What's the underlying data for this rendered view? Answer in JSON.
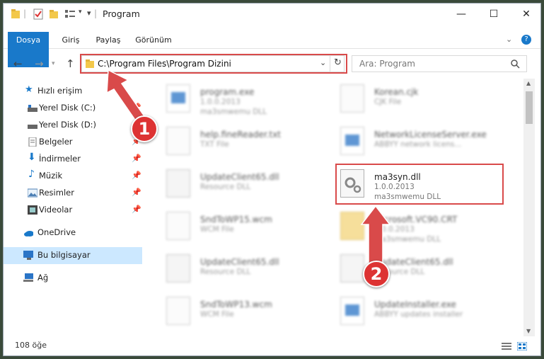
{
  "window": {
    "title": "Program",
    "controls": {
      "minimize": "—",
      "maximize": "☐",
      "close": "✕"
    }
  },
  "ribbon": {
    "tabs": [
      "Dosya",
      "Giriş",
      "Paylaş",
      "Görünüm"
    ]
  },
  "address": {
    "path": "C:\\Program Files\\Program Dizini",
    "search_placeholder": "Ara: Program"
  },
  "sidebar": {
    "items": [
      {
        "label": "Hızlı erişim",
        "icon": "star-icon"
      },
      {
        "label": "Yerel Disk (C:)",
        "icon": "drive-icon",
        "pinned": true
      },
      {
        "label": "Yerel Disk (D:)",
        "icon": "drive-icon"
      },
      {
        "label": "Belgeler",
        "icon": "documents-icon",
        "pinned": true
      },
      {
        "label": "İndirmeler",
        "icon": "download-icon",
        "pinned": true
      },
      {
        "label": "Müzik",
        "icon": "music-icon",
        "pinned": true
      },
      {
        "label": "Resimler",
        "icon": "pictures-icon",
        "pinned": true
      },
      {
        "label": "Videolar",
        "icon": "videos-icon",
        "pinned": true
      },
      {
        "label": "OneDrive",
        "icon": "cloud-icon"
      },
      {
        "label": "Bu bilgisayar",
        "icon": "computer-icon",
        "selected": true
      },
      {
        "label": "Ağ",
        "icon": "network-icon"
      }
    ]
  },
  "files": [
    {
      "name": "program.exe",
      "line2": "1.0.0.2013",
      "line3": "ma3smwemu DLL",
      "icon": "exe-file-icon"
    },
    {
      "name": "Korean.cjk",
      "line2": "CJK File",
      "line3": "",
      "icon": "document-icon"
    },
    {
      "name": "help.fineReader.txt",
      "line2": "TXT File",
      "line3": "",
      "icon": "document-icon"
    },
    {
      "name": "NetworkLicenseServer.exe",
      "line2": "ABBYY network licens...",
      "line3": "",
      "icon": "exe-file-icon"
    },
    {
      "name": "UpdateClient65.dll",
      "line2": "Resource DLL",
      "line3": "",
      "icon": "dll-file-icon"
    },
    {
      "name": "ma3syn.dll",
      "line2": "1.0.0.2013",
      "line3": "ma3smwemu DLL",
      "icon": "dll-file-icon"
    },
    {
      "name": "SndToWP15.wcm",
      "line2": "WCM File",
      "line3": "",
      "icon": "document-icon"
    },
    {
      "name": "Microsoft.VC90.CRT",
      "line2": "1.0.0.2013",
      "line3": "ma3smwemu DLL",
      "icon": "folder-icon"
    },
    {
      "name": "UpdateClient65.dll",
      "line2": "Resource DLL",
      "line3": "",
      "icon": "dll-file-icon"
    },
    {
      "name": "UpdateClient65.dll",
      "line2": "Resource DLL",
      "line3": "",
      "icon": "dll-file-icon"
    },
    {
      "name": "SndToWP13.wcm",
      "line2": "WCM File",
      "line3": "",
      "icon": "document-icon"
    },
    {
      "name": "UpdateInstaller.exe",
      "line2": "ABBYY updates installer",
      "line3": "",
      "icon": "exe-file-icon"
    }
  ],
  "status": {
    "count": "108 öğe"
  },
  "annotations": {
    "step1": "1",
    "step2": "2",
    "color": "#d94a4a"
  }
}
